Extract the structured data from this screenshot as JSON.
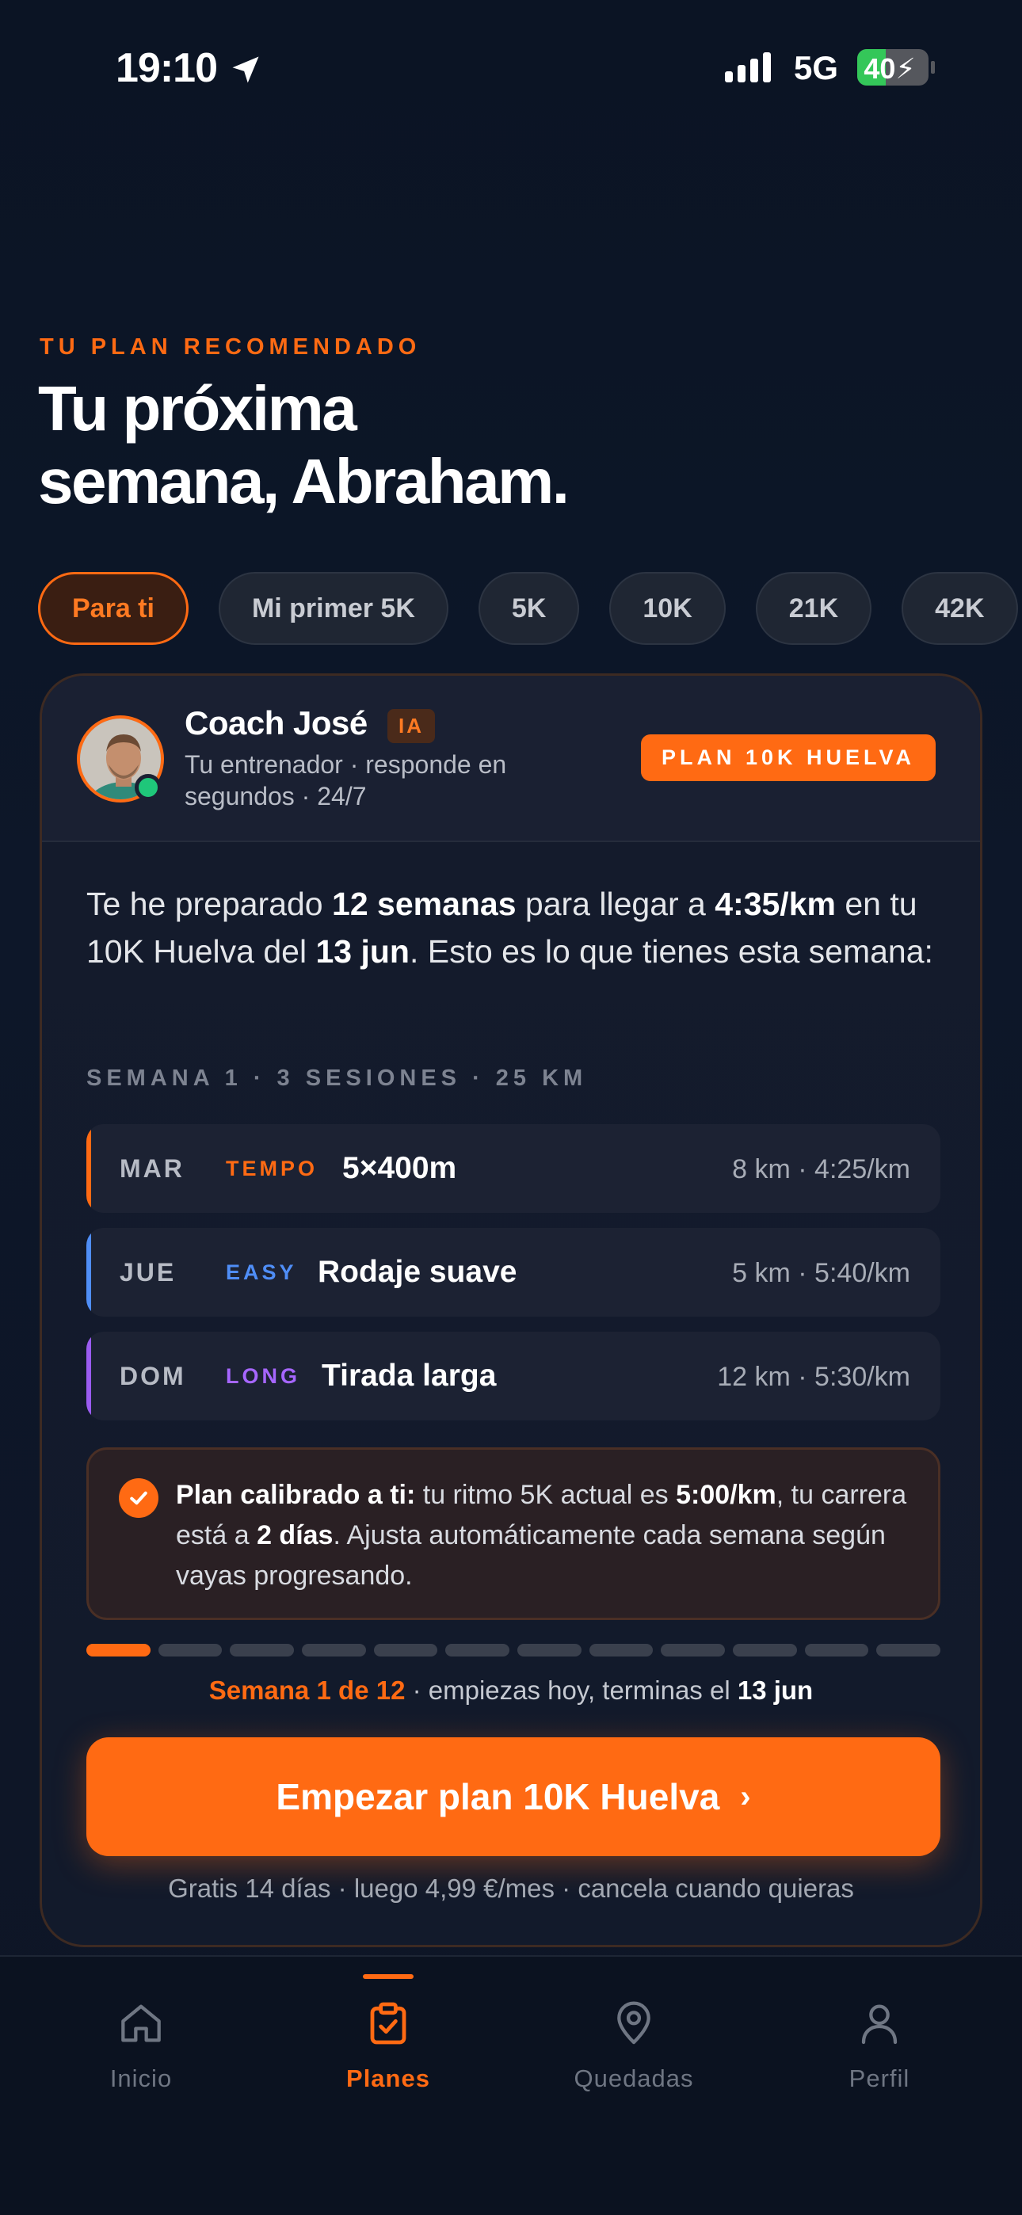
{
  "status_bar": {
    "time": "19:10",
    "network": "5G",
    "battery": "40",
    "battery_level": 0.4,
    "icons": [
      "location-arrow-icon",
      "signal-icon",
      "battery-charging-icon"
    ]
  },
  "header": {
    "eyebrow": "TU PLAN RECOMENDADO",
    "title_line1": "Tu próxima",
    "title_line2": "semana, Abraham."
  },
  "chips": [
    {
      "label": "Para ti",
      "active": true
    },
    {
      "label": "Mi primer 5K",
      "active": false
    },
    {
      "label": "5K",
      "active": false
    },
    {
      "label": "10K",
      "active": false
    },
    {
      "label": "21K",
      "active": false
    },
    {
      "label": "42K",
      "active": false
    }
  ],
  "coach": {
    "name": "Coach José",
    "badge": "IA",
    "subtitle": "Tu entrenador · responde en segundos · 24/7",
    "plan_badge": "PLAN 10K HUELVA"
  },
  "intro": {
    "p1": "Te he preparado ",
    "b1": "12 semanas",
    "p2": " para llegar a ",
    "b2": "4:35/km",
    "p3": " en tu 10K Huelva del ",
    "b3": "13 jun",
    "p4": ". Esto es lo que tienes esta semana:"
  },
  "week_label": "SEMANA 1 · 3 SESIONES · 25 KM",
  "sessions": [
    {
      "day": "MAR",
      "type": "TEMPO",
      "name": "5×400m",
      "meta": "8 km · 4:25/km",
      "color": "#ff6a13"
    },
    {
      "day": "JUE",
      "type": "EASY",
      "name": "Rodaje suave",
      "meta": "5 km · 5:40/km",
      "color": "#4f8ef7"
    },
    {
      "day": "DOM",
      "type": "LONG",
      "name": "Tirada larga",
      "meta": "12 km · 5:30/km",
      "color": "#9b5cf0"
    }
  ],
  "calibration": {
    "b1": "Plan calibrado a ti:",
    "p1": " tu ritmo 5K actual es ",
    "b2": "5:00/km",
    "p2": ", tu carrera está a ",
    "b3": "2 días",
    "p3": ". Ajusta automáticamente cada semana según vayas progresando."
  },
  "progress": {
    "current_week": 1,
    "total_weeks": 12,
    "highlight": "Semana 1 de 12",
    "text": " · empiezas hoy, terminas el ",
    "end": "13 jun"
  },
  "cta": {
    "label": "Empezar plan 10K Huelva",
    "chevron": "›"
  },
  "price_note": "Gratis 14 días · luego 4,99 €/mes · cancela cuando quieras",
  "tabbar": [
    {
      "label": "Inicio",
      "icon": "home-icon",
      "active": false
    },
    {
      "label": "Planes",
      "icon": "clipboard-check-icon",
      "active": true
    },
    {
      "label": "Quedadas",
      "icon": "map-pin-icon",
      "active": false
    },
    {
      "label": "Perfil",
      "icon": "user-icon",
      "active": false
    }
  ],
  "colors": {
    "accent": "#ff6a13",
    "background": "#0c1626",
    "card": "#141b2c",
    "easy": "#4f8ef7",
    "long": "#9b5cf0"
  }
}
